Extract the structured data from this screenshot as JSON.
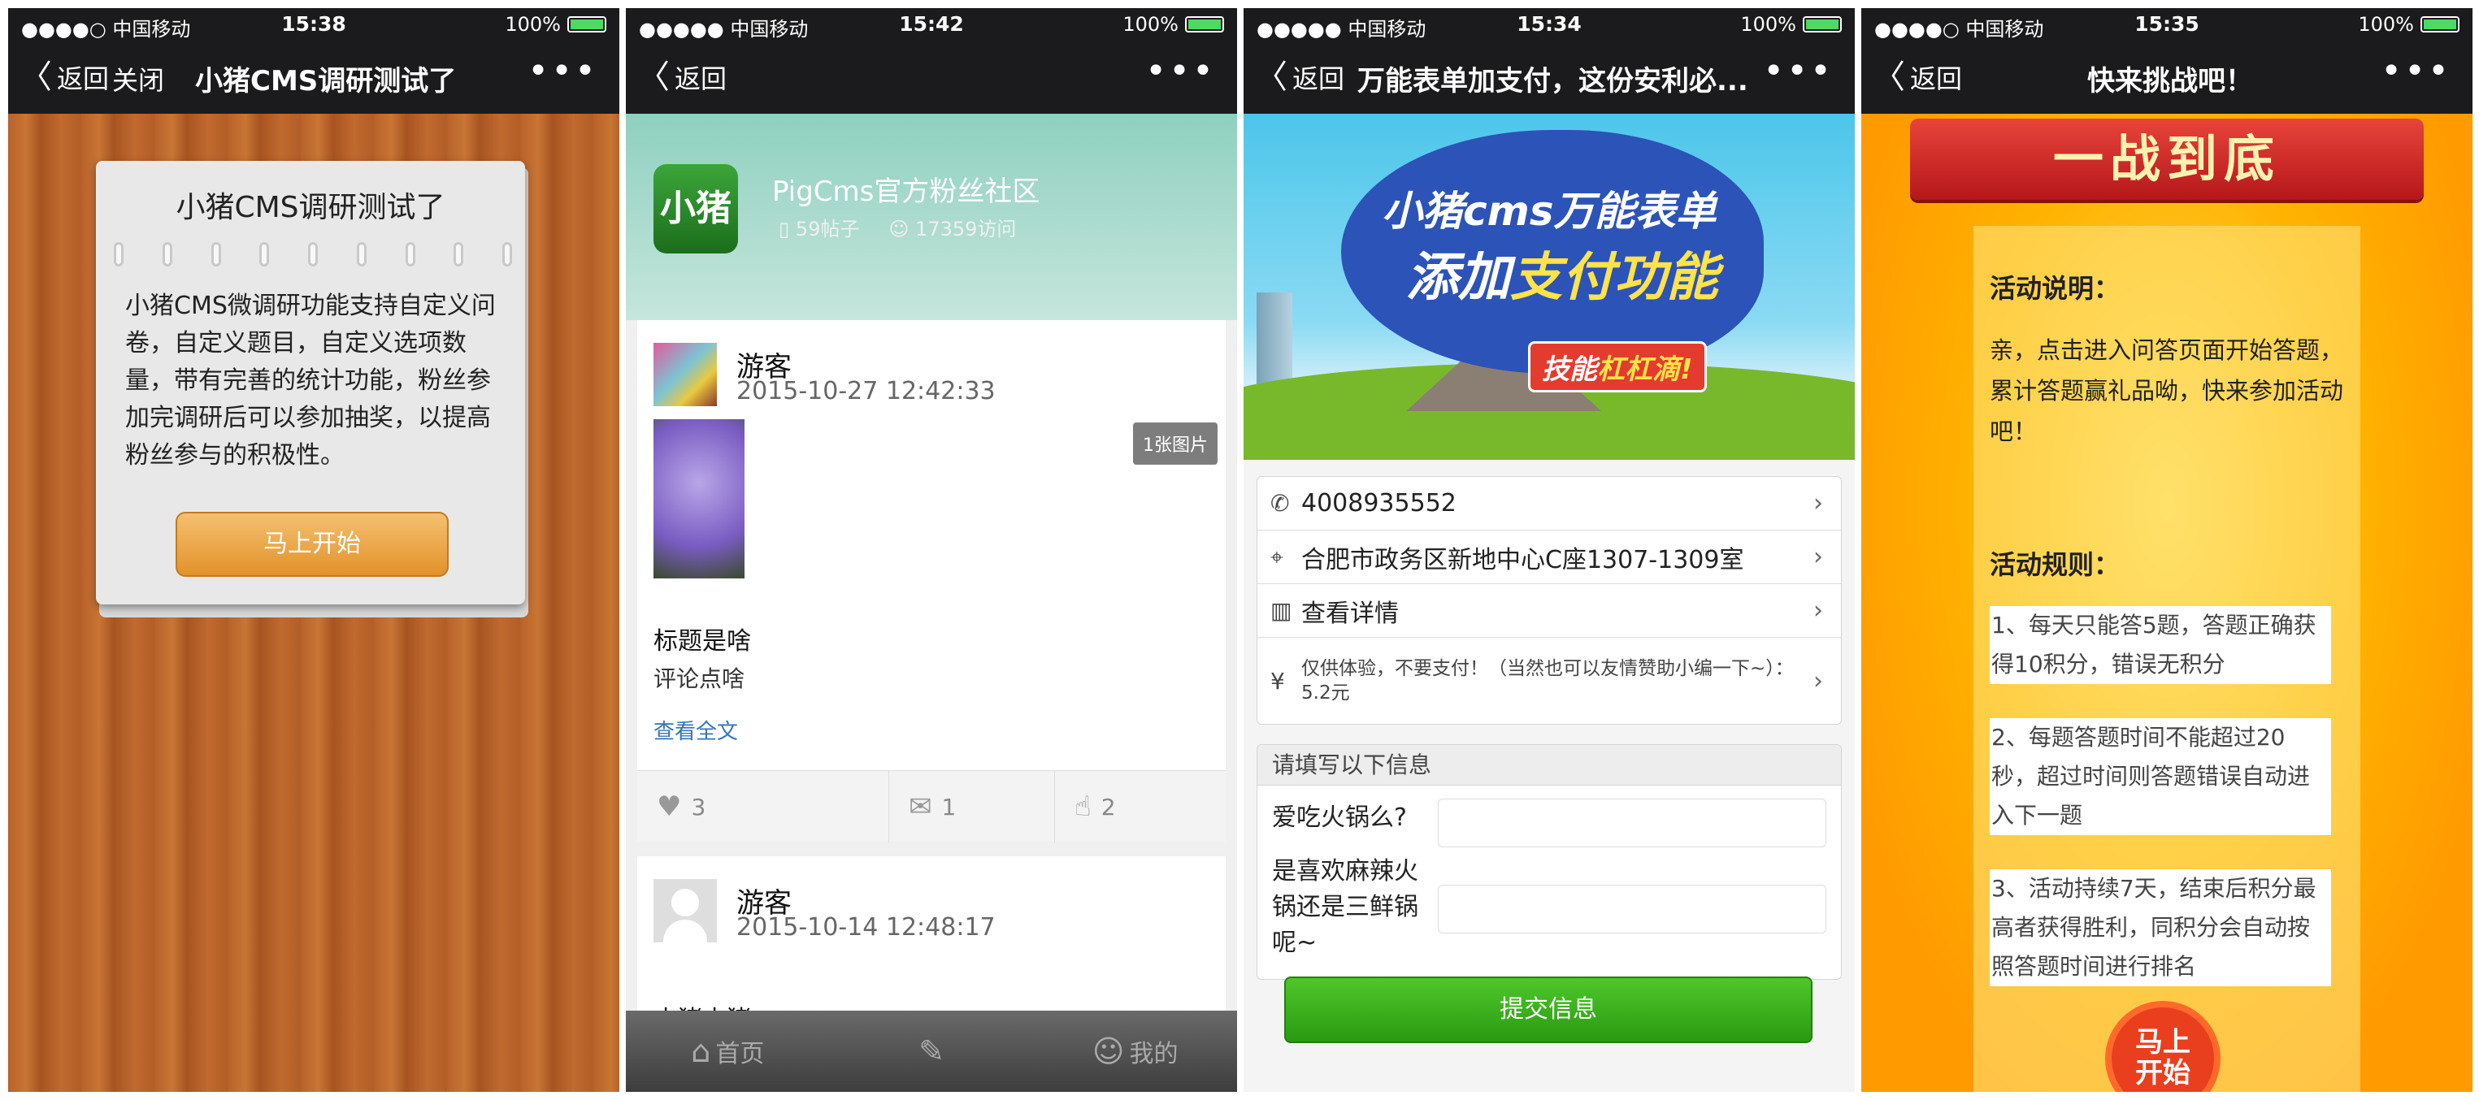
{
  "status_bars": [
    {
      "carrier": "●●●●○ 中国移动",
      "time": "15:38",
      "battery": "100%"
    },
    {
      "carrier": "●●●●● 中国移动",
      "time": "15:42",
      "battery": "100%"
    },
    {
      "carrier": "●●●●● 中国移动",
      "time": "15:34",
      "battery": "100%"
    },
    {
      "carrier": "●●●●○ 中国移动",
      "time": "15:35",
      "battery": "100%"
    }
  ],
  "common": {
    "back_label": "返回",
    "close_label": "关闭",
    "more_glyph": "•••",
    "back_chevron": "〈",
    "row_chevron": "›"
  },
  "screen1": {
    "nav_title": "小猪CMS调研测试了",
    "card_title": "小猪CMS调研测试了",
    "description": "小猪CMS微调研功能支持自定义问卷，自定义题目，自定义选项数量，带有完善的统计功能，粉丝参加完调研后可以参加抽奖，以提高粉丝参与的积极性。",
    "start_button": "马上开始"
  },
  "screen2": {
    "logo_text": "小猪",
    "community_name": "PigCms官方粉丝社区",
    "posts_count": "59帖子",
    "visits_count": "17359访问",
    "posts": [
      {
        "user": "游客",
        "date": "2015-10-27 12:42:33",
        "image_badge": "1张图片",
        "title": "标题是啥",
        "body": "评论点啥",
        "read_more": "查看全文",
        "likes": "3",
        "comments": "1",
        "thumbs": "2"
      },
      {
        "user": "游客",
        "date": "2015-10-14 12:48:17",
        "title": "小猪小猪"
      }
    ],
    "tabbar": {
      "home": "首页",
      "compose": "",
      "mine": "我的"
    }
  },
  "screen3": {
    "nav_title": "万能表单加支付，这份安利必...",
    "banner_line1": "小猪cms万能表单",
    "banner_line2a": "添加",
    "banner_line2b": "支付功能",
    "banner_tag_a": "技能",
    "banner_tag_b": "杠杠滴!",
    "phone": "4008935552",
    "address": "合肥市政务区新地中心C座1307-1309室",
    "details": "查看详情",
    "payment_note": "仅供体验，不要支付！（当然也可以友情赞助小编一下~）：5.2元",
    "form_header": "请填写以下信息",
    "q1": "爱吃火锅么?",
    "q2": "是喜欢麻辣火锅还是三鲜锅呢~",
    "submit_button": "提交信息"
  },
  "screen4": {
    "nav_title": "快来挑战吧！",
    "ribbon_title": "一战到底",
    "desc_heading": "活动说明：",
    "desc_text": "亲，点击进入问答页面开始答题，累计答题赢礼品呦，快来参加活动吧！",
    "rules_heading": "活动规则：",
    "rules": [
      "1、每天只能答5题，答题正确获得10积分，错误无积分",
      "2、每题答题时间不能超过20秒，超过时间则答题错误自动进入下一题",
      "3、活动持续7天，结束后积分最高者获得胜利，同积分会自动按照答题时间进行排名"
    ],
    "start_button_line1": "马上",
    "start_button_line2": "开始"
  }
}
